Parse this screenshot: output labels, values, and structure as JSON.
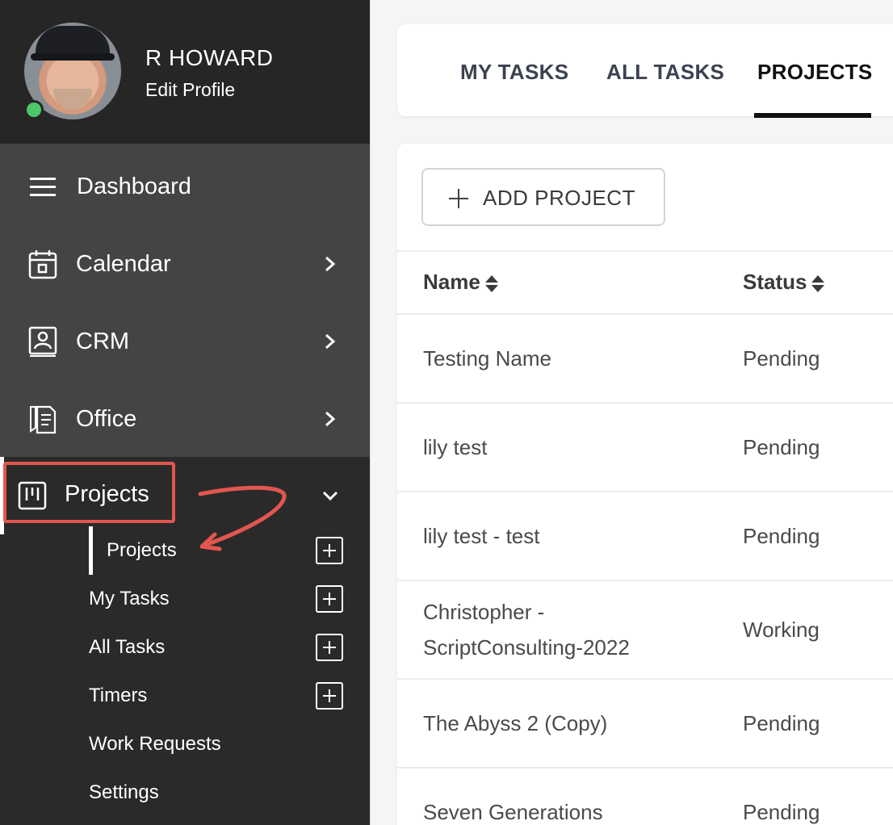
{
  "profile": {
    "name": "R HOWARD",
    "edit_label": "Edit Profile",
    "status_color": "#4cc76a"
  },
  "sidebar": {
    "items": [
      {
        "label": "Dashboard",
        "icon": "menu-lines-icon"
      },
      {
        "label": "Calendar",
        "icon": "calendar-icon"
      },
      {
        "label": "CRM",
        "icon": "contact-book-icon"
      },
      {
        "label": "Office",
        "icon": "documents-icon"
      },
      {
        "label": "Projects",
        "icon": "kanban-icon"
      }
    ],
    "sub_items": [
      {
        "label": "Projects",
        "has_add": true
      },
      {
        "label": "My Tasks",
        "has_add": true
      },
      {
        "label": "All Tasks",
        "has_add": true
      },
      {
        "label": "Timers",
        "has_add": true
      },
      {
        "label": "Work Requests",
        "has_add": false
      },
      {
        "label": "Settings",
        "has_add": false
      }
    ],
    "highlight_color": "#e2564f"
  },
  "tabs": [
    {
      "label": "MY TASKS"
    },
    {
      "label": "ALL TASKS"
    },
    {
      "label": "PROJECTS",
      "active": true
    }
  ],
  "add_button": {
    "label": "ADD PROJECT"
  },
  "table": {
    "headers": [
      "Name",
      "Status"
    ],
    "rows": [
      {
        "name": "Testing Name",
        "status": "Pending"
      },
      {
        "name": "lily test",
        "status": "Pending"
      },
      {
        "name": "lily test - test",
        "status": "Pending"
      },
      {
        "name_line1": "Christopher -",
        "name_line2": "ScriptConsulting-2022",
        "status": "Working"
      },
      {
        "name": "The Abyss 2 (Copy)",
        "status": "Pending"
      },
      {
        "name": "Seven Generations",
        "status": "Pending"
      }
    ]
  }
}
